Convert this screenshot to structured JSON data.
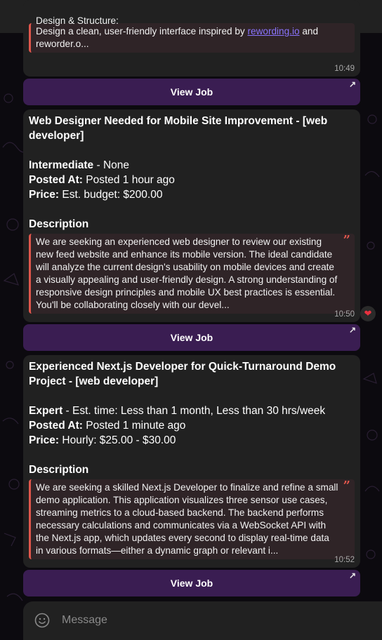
{
  "chat": {
    "messages": [
      {
        "partial_heading": "Design & Structure:",
        "quote_prefix": "Design a clean, user-friendly interface inspired by ",
        "quote_link": "rewording.io",
        "quote_suffix": " and reworder.o...",
        "time": "10:49",
        "button": "View Job"
      },
      {
        "title": "Web Designer Needed for Mobile Site Improvement - [web developer]",
        "level": "Intermediate",
        "level_detail": " - None",
        "posted_label": "Posted At:",
        "posted_value": " Posted 1 hour ago",
        "price_label": "Price:",
        "price_value": " Est. budget: $200.00",
        "description_label": "Description",
        "description": "We are seeking an experienced web designer to review our existing new feed website and enhance its mobile version. The ideal candidate will analyze the current design's usability on mobile devices and create a visually appealing and user-friendly design. A strong understanding of responsive design principles and mobile UX best practices is essential. You'll be collaborating closely with our devel...",
        "time": "10:50",
        "reaction": "❤",
        "button": "View Job"
      },
      {
        "title": "Experienced Next.js Developer for Quick-Turnaround Demo Project - [web developer]",
        "level": "Expert",
        "level_detail": " - Est. time: Less than 1 month, Less than 30 hrs/week",
        "posted_label": "Posted At:",
        "posted_value": " Posted 1 minute ago",
        "price_label": "Price:",
        "price_value": " Hourly: $25.00 - $30.00",
        "description_label": "Description",
        "description": "We are seeking a skilled Next.js Developer to finalize and refine a small demo application. This application visualizes three sensor use cases, streaming metrics to a cloud-based backend. The backend performs necessary calculations and communicates via a WebSocket API with the Next.js app, which updates every second to display real-time data in various formats—either a dynamic graph or relevant i...",
        "time": "10:52",
        "button": "View Job"
      }
    ]
  },
  "composer": {
    "placeholder": "Message"
  },
  "colors": {
    "accent": "#e0564c",
    "button_bg": "#3a1d52",
    "link": "#8a74ff"
  }
}
